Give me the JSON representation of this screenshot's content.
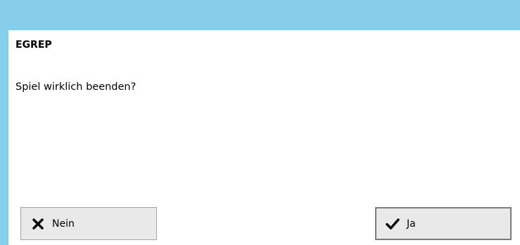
{
  "dialog": {
    "title": "EGREP",
    "message": "Spiel wirklich beenden?"
  },
  "buttons": {
    "no": {
      "label": "Nein",
      "icon": "close-icon"
    },
    "yes": {
      "label": "Ja",
      "icon": "checkmark-icon"
    }
  },
  "colors": {
    "titlebar": "#87ceeb",
    "button_bg": "#e9e9e9"
  }
}
